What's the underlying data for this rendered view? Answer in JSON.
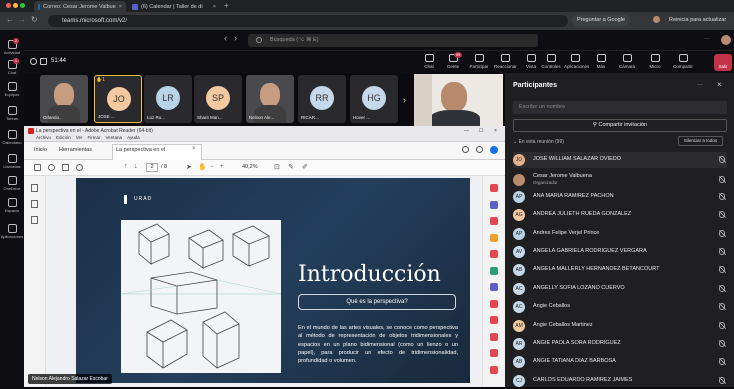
{
  "browser": {
    "tabs": [
      {
        "label": "Correo: Cesar Jerome Valbue"
      },
      {
        "label": "(6) Calendar | Taller de di"
      }
    ],
    "url": "teams.microsoft.com/v2/",
    "ask_google": "Preguntar a Google",
    "restart": "Reinicia para actualizar"
  },
  "rail": [
    {
      "label": "Actividad",
      "badge": "2"
    },
    {
      "label": "Chat",
      "badge": "1"
    },
    {
      "label": "Equipos",
      "badge": ""
    },
    {
      "label": "Tareas",
      "badge": ""
    },
    {
      "label": "Calendario",
      "badge": ""
    },
    {
      "label": "Llamadas",
      "badge": ""
    },
    {
      "label": "OneDrive",
      "badge": ""
    },
    {
      "label": "Espacio",
      "badge": ""
    },
    {
      "label": "Aplicaciones",
      "badge": ""
    }
  ],
  "search_placeholder": "Búsqueda (⌥ ⌘ E)",
  "meeting": {
    "timer": "51:44",
    "tools": [
      "Chat",
      "Gente",
      "Participar",
      "Reaccionar",
      "Vista",
      "Controles",
      "Aplicaciones",
      "Más",
      "Cámara",
      "Micro",
      "Compartir"
    ],
    "leave": "Salir",
    "gente_badge": "99"
  },
  "tiles": [
    {
      "name": "Orlando...",
      "initials": ""
    },
    {
      "name": "JOSE ...",
      "initials": "JO"
    },
    {
      "name": "Luz Ro...",
      "initials": "LR"
    },
    {
      "name": "Sharit Man...",
      "initials": "SP"
    },
    {
      "name": "Nelson Ale...",
      "initials": ""
    },
    {
      "name": "RICAR...",
      "initials": "RR"
    },
    {
      "name": "Hover ...",
      "initials": "HG"
    }
  ],
  "hand_count": "1",
  "acrobat": {
    "title": "La perspectiva en el - Adobe Acrobat Reader (64-bit)",
    "menu": [
      "Archivo",
      "Edición",
      "Ver",
      "Firmar",
      "Ventana",
      "Ayuda"
    ],
    "tabs": [
      "Inicio",
      "Herramientas",
      "La perspectiva en el"
    ],
    "page": "2",
    "pages": "/ 8",
    "zoom": "40,2%"
  },
  "slide": {
    "logo": "URAD",
    "title": "Introducción",
    "question": "Qué es la perspectiva?",
    "body": "En el mundo de las artes visuales, se conoce como perspectiva al método de representación de objetos tridimensionales y espacios en un plano bidimensional (como un lienzo o un papel), para producir un efecto de tridimensionalidad, profundidad o volumen."
  },
  "presenter": "Nelson Alejandro Salazar Escobar",
  "panel": {
    "title": "Participantes",
    "search_placeholder": "Escribe un nombre",
    "share_invite": "Compartir invitación",
    "in_meeting": "En esta reunión (99)",
    "mute_all": "Silenciar a todos",
    "organizer": "Organizador",
    "participants": [
      {
        "name": "JOSE WILLIAM SALAZAR OVIEDO",
        "initials": "JO",
        "color": "#e3b28a"
      },
      {
        "name": "Cesar Jerome Valbuena",
        "initials": "",
        "color": "#b98a6c"
      },
      {
        "name": "ANA MARIA RAMIREZ PACHON",
        "initials": "AP",
        "color": "#b9d3e8"
      },
      {
        "name": "ANDREA JULIETH RUEDA GONZALEZ",
        "initials": "AG",
        "color": "#f3c9a0"
      },
      {
        "name": "Andres Felipe Verjel Prince",
        "initials": "AP",
        "color": "#b9d3e8"
      },
      {
        "name": "ANGELA GABRIELA RODRIGUEZ VERGARA",
        "initials": "AV",
        "color": "#c5d9ea"
      },
      {
        "name": "ANGELA MALLERLY HERNANDEZ BETANCOURT",
        "initials": "AB",
        "color": "#c5d9ea"
      },
      {
        "name": "ANGELLY SOFIA LOZANO CUERVO",
        "initials": "AC",
        "color": "#c5d9ea"
      },
      {
        "name": "Angie Ceballos",
        "initials": "AC",
        "color": "#c5d9ea"
      },
      {
        "name": "Angie Ceballos Martinez",
        "initials": "AM",
        "color": "#f3c9a0"
      },
      {
        "name": "ANGIE PAOLA SORA RODRIGUEZ",
        "initials": "AR",
        "color": "#c5d9ea"
      },
      {
        "name": "ANGIE TATIANA DIAZ BARBOSA",
        "initials": "AB",
        "color": "#c5d9ea"
      },
      {
        "name": "CARLOS EDUARDO RAMIREZ JAIMES",
        "initials": "CJ",
        "color": "#c5d9ea"
      }
    ]
  }
}
